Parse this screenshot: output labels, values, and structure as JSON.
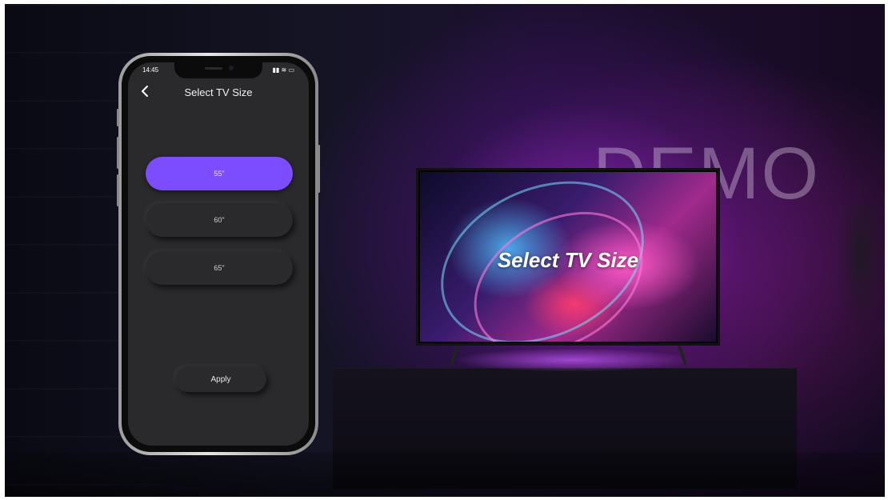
{
  "phone": {
    "status_time": "14:45",
    "status_icons": "▮▮ ≋ ▭",
    "title": "Select TV Size",
    "sizes": [
      {
        "label": "55\"",
        "selected": true
      },
      {
        "label": "60\"",
        "selected": false
      },
      {
        "label": "65\"",
        "selected": false
      }
    ],
    "apply_label": "Apply",
    "accent_color": "#7c4dff"
  },
  "tv": {
    "caption": "Select TV Size"
  },
  "watermark": "DEMO"
}
